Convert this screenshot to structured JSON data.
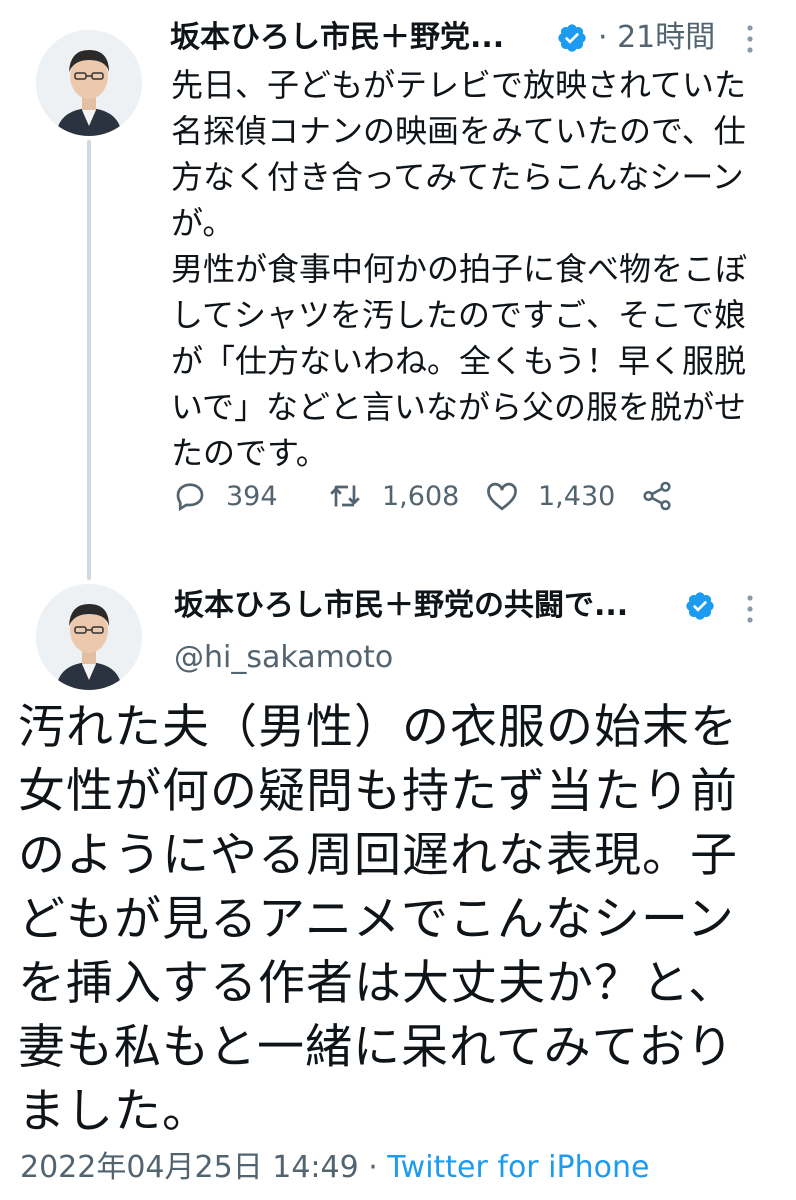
{
  "tweet1": {
    "author_name": "坂本ひろし市民＋野党...",
    "time": "· 21時間",
    "text": "先日、子どもがテレビで放映されていた\n名探偵コナンの映画をみていたので、仕\n方なく付き合ってみてたらこんなシーン\nが。\n男性が食事中何かの拍子に食べ物をこぼ\nしてシャツを汚したのですご、そこで娘\nが「仕方ないわね。全くもう！早く服脱\nいで」などと言いながら父の服を脱がせ\nたのです。",
    "reply_count": "394",
    "retweet_count": "1,608",
    "like_count": "1,430"
  },
  "tweet2": {
    "author_name": "坂本ひろし市民＋野党の共闘で...",
    "handle": "@hi_sakamoto",
    "text": "汚れた夫（男性）の衣服の始末を\n女性が何の疑問も持たず当たり前\nのようにやる周回遅れな表現。子\nどもが見るアニメでこんなシーン\nを挿入する作者は大丈夫か？と、\n妻も私もと一緒に呆れてみており\nました。",
    "date": "2022年04月25日 14:49",
    "separator": " · ",
    "source": "Twitter for iPhone"
  },
  "colors": {
    "verified": "#1d9bf0",
    "muted": "#536471",
    "link": "#1d9bf0",
    "thread_line": "#cfd9de"
  },
  "icons": [
    "verified-badge-icon",
    "more-icon",
    "reply-icon",
    "retweet-icon",
    "like-icon",
    "share-icon"
  ]
}
